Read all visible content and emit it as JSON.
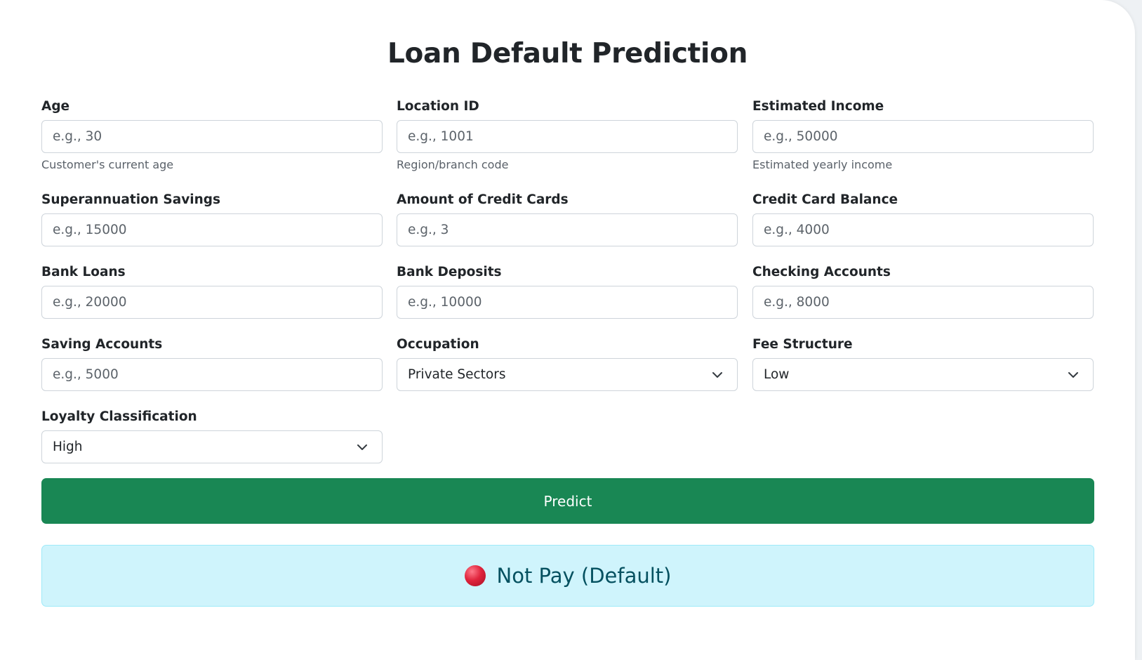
{
  "page": {
    "title": "Loan Default Prediction"
  },
  "fields": {
    "age": {
      "label": "Age",
      "placeholder": "e.g., 30",
      "help": "Customer's current age"
    },
    "location_id": {
      "label": "Location ID",
      "placeholder": "e.g., 1001",
      "help": "Region/branch code"
    },
    "estimated_income": {
      "label": "Estimated Income",
      "placeholder": "e.g., 50000",
      "help": "Estimated yearly income"
    },
    "superannuation_savings": {
      "label": "Superannuation Savings",
      "placeholder": "e.g., 15000"
    },
    "amount_credit_cards": {
      "label": "Amount of Credit Cards",
      "placeholder": "e.g., 3"
    },
    "credit_card_balance": {
      "label": "Credit Card Balance",
      "placeholder": "e.g., 4000"
    },
    "bank_loans": {
      "label": "Bank Loans",
      "placeholder": "e.g., 20000"
    },
    "bank_deposits": {
      "label": "Bank Deposits",
      "placeholder": "e.g., 10000"
    },
    "checking_accounts": {
      "label": "Checking Accounts",
      "placeholder": "e.g., 8000"
    },
    "saving_accounts": {
      "label": "Saving Accounts",
      "placeholder": "e.g., 5000"
    },
    "occupation": {
      "label": "Occupation",
      "value": "Private Sectors"
    },
    "fee_structure": {
      "label": "Fee Structure",
      "value": "Low"
    },
    "loyalty_classification": {
      "label": "Loyalty Classification",
      "value": "High"
    }
  },
  "actions": {
    "predict_label": "Predict"
  },
  "result": {
    "icon": "red-circle-icon",
    "text": "Not Pay (Default)"
  },
  "colors": {
    "primary_button": "#198754",
    "alert_background": "#cff4fc",
    "alert_text": "#055160",
    "result_dot": "#e0243c"
  }
}
